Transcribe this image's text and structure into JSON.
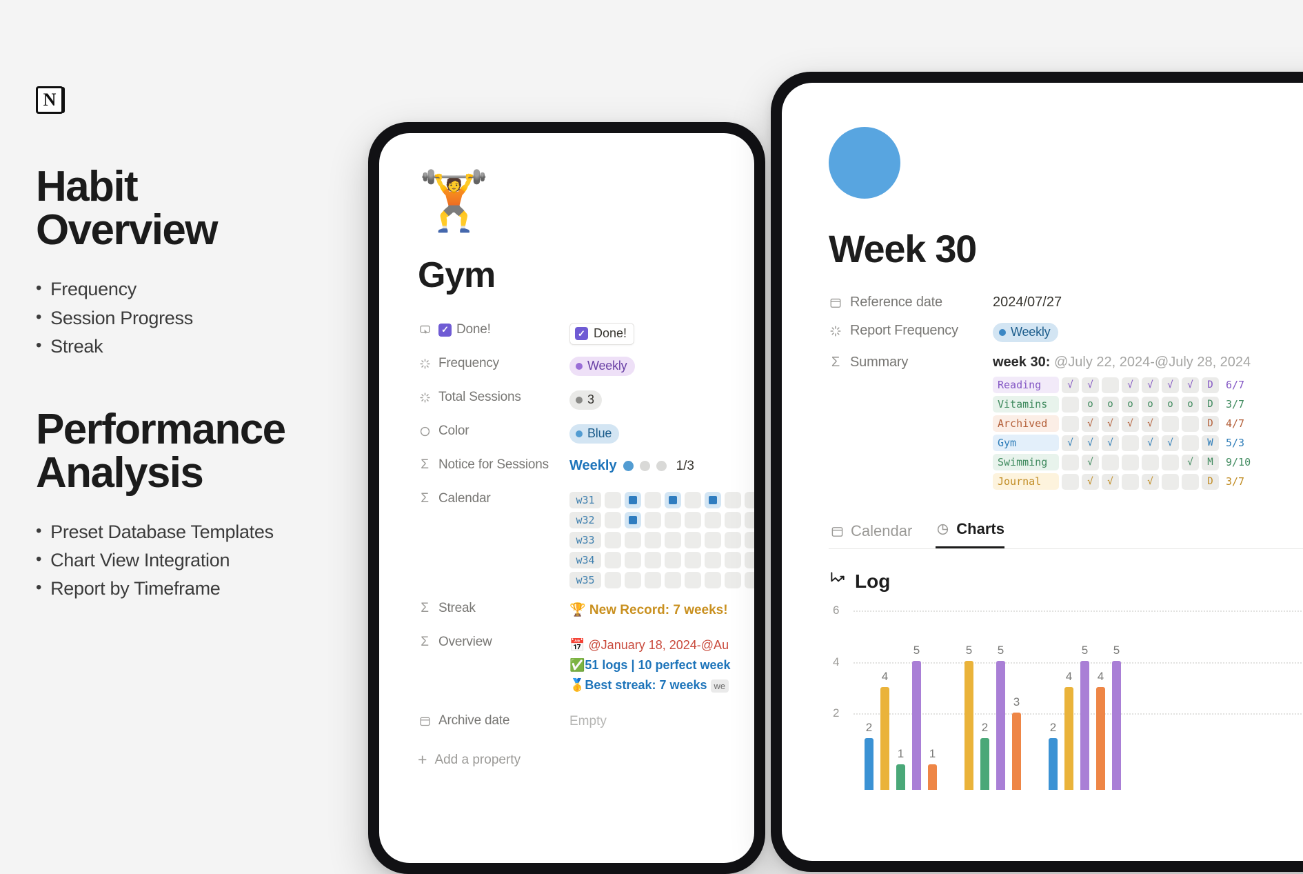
{
  "left_panel": {
    "logo": "N",
    "title_1": "Habit\nOverview",
    "title_1_line1": "Habit",
    "title_1_line2": "Overview",
    "bullets_1": [
      "Frequency",
      "Session Progress",
      "Streak"
    ],
    "title_2_line1": "Performance",
    "title_2_line2": "Analysis",
    "bullets_2": [
      "Preset Database Templates",
      "Chart View Integration",
      "Report by Timeframe"
    ]
  },
  "gym_page": {
    "emoji": "🏋️",
    "title": "Gym",
    "properties": [
      {
        "icon": "click-icon",
        "label": "Done!",
        "type": "checkbox_label"
      },
      {
        "icon": "select-icon",
        "label": "Frequency",
        "type": "pill",
        "value": "Weekly",
        "color": "purple"
      },
      {
        "icon": "select-icon",
        "label": "Total Sessions",
        "type": "pill",
        "value": "3",
        "color": "gray"
      },
      {
        "icon": "circle-icon",
        "label": "Color",
        "type": "pill",
        "value": "Blue",
        "color": "blue"
      },
      {
        "icon": "sigma-icon",
        "label": "Notice for Sessions",
        "type": "notice"
      },
      {
        "icon": "sigma-icon",
        "label": "Calendar",
        "type": "calendar"
      },
      {
        "icon": "sigma-icon",
        "label": "Streak",
        "type": "streak"
      },
      {
        "icon": "sigma-icon",
        "label": "Overview",
        "type": "overview"
      },
      {
        "icon": "calendar-icon",
        "label": "Archive date",
        "type": "empty"
      }
    ],
    "done_value": "Done!",
    "done_label": "Done!",
    "notice": {
      "text": "Weekly",
      "filled": 1,
      "total_dots": 3,
      "fraction": "1/3"
    },
    "calendar_weeks": [
      {
        "week": "w31",
        "cells": [
          0,
          1,
          0,
          1,
          0,
          1,
          0,
          0
        ]
      },
      {
        "week": "w32",
        "cells": [
          0,
          1,
          0,
          0,
          0,
          0,
          0,
          0
        ]
      },
      {
        "week": "w33",
        "cells": [
          0,
          0,
          0,
          0,
          0,
          0,
          0,
          0
        ]
      },
      {
        "week": "w34",
        "cells": [
          0,
          0,
          0,
          0,
          0,
          0,
          0,
          0
        ]
      },
      {
        "week": "w35",
        "cells": [
          0,
          0,
          0,
          0,
          0,
          0,
          0,
          0
        ]
      }
    ],
    "streak_text": "🏆 New Record: 7 weeks!",
    "overview_lines": [
      "📅 @January 18, 2024-@Au",
      "✅51 logs | 10 perfect week",
      "🥇Best streak: 7 weeks"
    ],
    "overview_tag": "we",
    "archive_value": "Empty",
    "add_property": "Add a property"
  },
  "week_page": {
    "title": "Week 30",
    "properties": [
      {
        "icon": "calendar-icon",
        "label": "Reference date",
        "value": "2024/07/27"
      },
      {
        "icon": "select-icon",
        "label": "Report Frequency",
        "value": "Weekly"
      },
      {
        "icon": "sigma-icon",
        "label": "Summary",
        "value": ""
      }
    ],
    "frequency_pill": "Weekly",
    "summary_header_bold": "week 30:",
    "summary_header_range": "@July 22, 2024-@July 28, 2024",
    "habit_table": [
      {
        "name": "Reading",
        "name_bg": "#f2eaf9",
        "name_fg": "#8356c4",
        "mark_fg": "#8356c4",
        "marks": [
          "√",
          "√",
          "",
          "√",
          "√",
          "√",
          "√"
        ],
        "tail": "D",
        "score": "6/7"
      },
      {
        "name": "Vitamins",
        "name_bg": "#e8f3ec",
        "name_fg": "#3f8a5e",
        "mark_fg": "#3f8a5e",
        "marks": [
          "",
          "o",
          "o",
          "o",
          "o",
          "o",
          "o"
        ],
        "tail": "D",
        "score": "3/7"
      },
      {
        "name": "Archived",
        "name_bg": "#fbeee6",
        "name_fg": "#b4603a",
        "mark_fg": "#b4603a",
        "marks": [
          "",
          "√",
          "√",
          "√",
          "√",
          "",
          ""
        ],
        "tail": "D",
        "score": "4/7"
      },
      {
        "name": "Gym",
        "name_bg": "#e3effa",
        "name_fg": "#2d7cb8",
        "mark_fg": "#2d7cb8",
        "marks": [
          "√",
          "√",
          "√",
          "",
          "√",
          "√",
          ""
        ],
        "tail": "W",
        "score": "5/3"
      },
      {
        "name": "Swimming",
        "name_bg": "#e8f3ec",
        "name_fg": "#3f8a5e",
        "mark_fg": "#3f8a5e",
        "marks": [
          "",
          "√",
          "",
          "",
          "",
          "",
          "√"
        ],
        "tail": "M",
        "score": "9/10"
      },
      {
        "name": "Journal",
        "name_bg": "#fdf3dd",
        "name_fg": "#c08b22",
        "mark_fg": "#c08b22",
        "marks": [
          "",
          "√",
          "√",
          "",
          "√",
          "",
          ""
        ],
        "tail": "D",
        "score": "3/7"
      }
    ],
    "tabs": [
      {
        "label": "Calendar",
        "icon": "calendar-icon",
        "active": false
      },
      {
        "label": "Charts",
        "icon": "pie-chart-icon",
        "active": true
      }
    ],
    "log_heading": "Log",
    "log_icon": "trend-up-icon"
  },
  "chart_data": {
    "type": "bar",
    "title": "Log",
    "xlabel": "",
    "ylabel": "",
    "ylim": [
      0,
      6
    ],
    "yticks": [
      2,
      4,
      6
    ],
    "grid": true,
    "legend": "none",
    "colors": {
      "blue": "#3b92d4",
      "yellow": "#eab33a",
      "purple": "#a97fd6",
      "green": "#4aa878",
      "orange": "#ee8646"
    },
    "groups": [
      {
        "bars": [
          {
            "color": "blue",
            "value": 2
          },
          {
            "color": "yellow",
            "value": 4
          },
          {
            "color": "green",
            "value": 1
          },
          {
            "color": "purple",
            "value": 5
          },
          {
            "color": "orange",
            "value": 1
          }
        ]
      },
      {
        "bars": [
          {
            "color": "yellow",
            "value": 5
          },
          {
            "color": "green",
            "value": 2
          },
          {
            "color": "purple",
            "value": 5
          },
          {
            "color": "orange",
            "value": 3
          }
        ]
      },
      {
        "bars": [
          {
            "color": "blue",
            "value": 2
          },
          {
            "color": "yellow",
            "value": 4
          },
          {
            "color": "purple",
            "value": 5
          },
          {
            "color": "orange",
            "value": 4
          },
          {
            "color": "purple",
            "value": 5
          }
        ]
      }
    ]
  }
}
